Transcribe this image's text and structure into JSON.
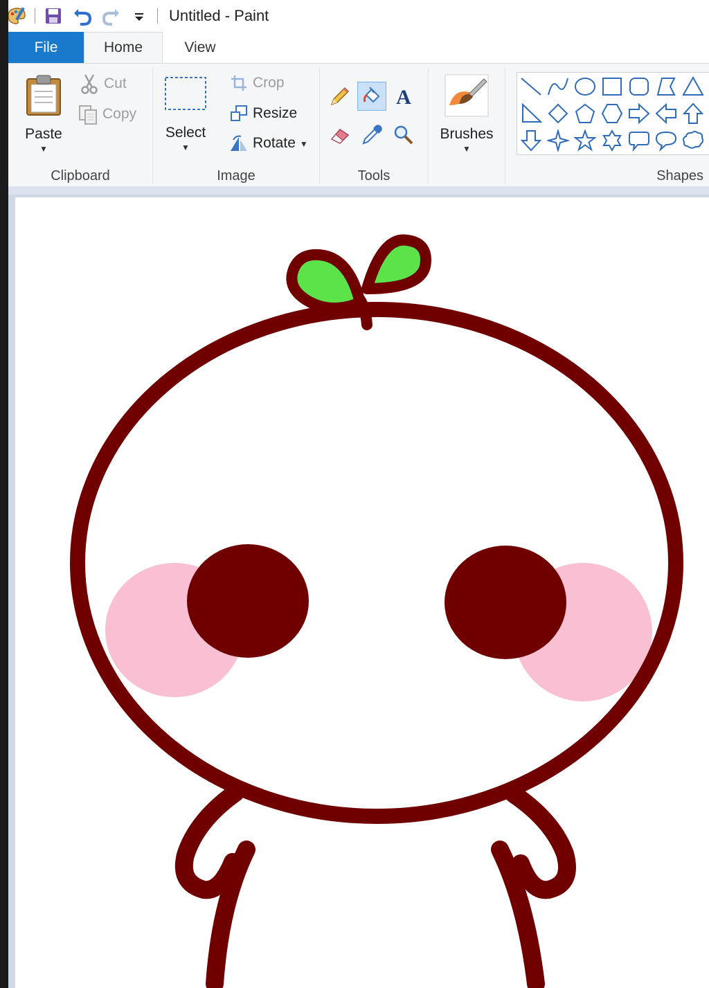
{
  "window": {
    "title": "Untitled - Paint"
  },
  "quick_access": {
    "app_icon": "paint-palette-icon",
    "save_icon": "save-icon",
    "undo_icon": "undo-icon",
    "redo_icon": "redo-icon",
    "customize_icon": "customize-dropdown-icon"
  },
  "tabs": [
    {
      "label": "File"
    },
    {
      "label": "Home"
    },
    {
      "label": "View"
    }
  ],
  "ribbon": {
    "clipboard": {
      "label": "Clipboard",
      "paste": "Paste",
      "cut": "Cut",
      "copy": "Copy"
    },
    "image": {
      "label": "Image",
      "select": "Select",
      "crop": "Crop",
      "resize": "Resize",
      "rotate": "Rotate"
    },
    "tools": {
      "label": "Tools",
      "active_tool": "fill-bucket"
    },
    "brushes": {
      "label": "Brushes"
    },
    "shapes": {
      "label": "Shapes",
      "items": [
        "line",
        "curve",
        "oval",
        "rectangle",
        "rounded-rectangle",
        "polygon",
        "triangle",
        "right-triangle",
        "diamond",
        "pentagon",
        "hexagon",
        "right-arrow",
        "left-arrow",
        "up-arrow",
        "down-arrow",
        "four-point-star",
        "five-point-star",
        "six-point-star",
        "rounded-callout",
        "oval-callout",
        "cloud-callout"
      ]
    }
  },
  "colors": {
    "file_tab": "#1979ca",
    "drawing_outline": "#700000",
    "leaf_fill": "#5ce34a",
    "blush": "#f8b9cf"
  }
}
